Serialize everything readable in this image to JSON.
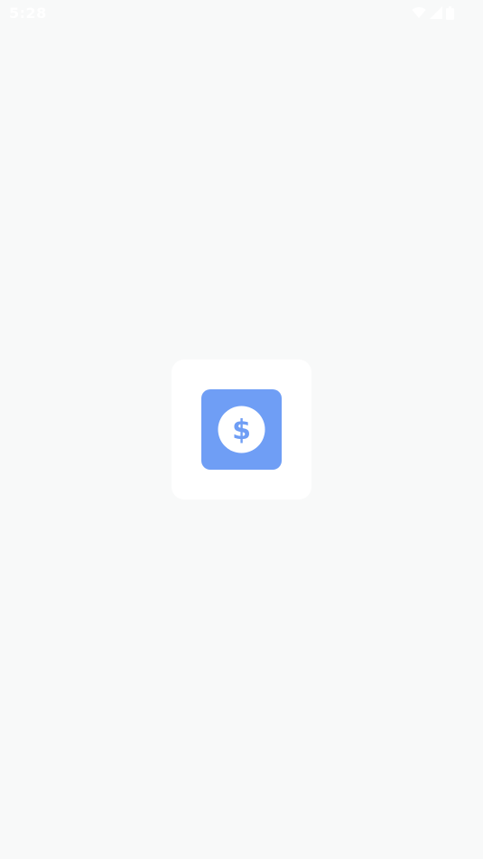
{
  "status_bar": {
    "time": "5:28",
    "icons": [
      "wifi-icon",
      "signal-icon",
      "battery-icon"
    ]
  },
  "splash": {
    "icon": "dollar-coin-icon",
    "icon_background": "#6f9ef5",
    "card_background": "#ffffff",
    "page_background": "#f8f9f9"
  }
}
